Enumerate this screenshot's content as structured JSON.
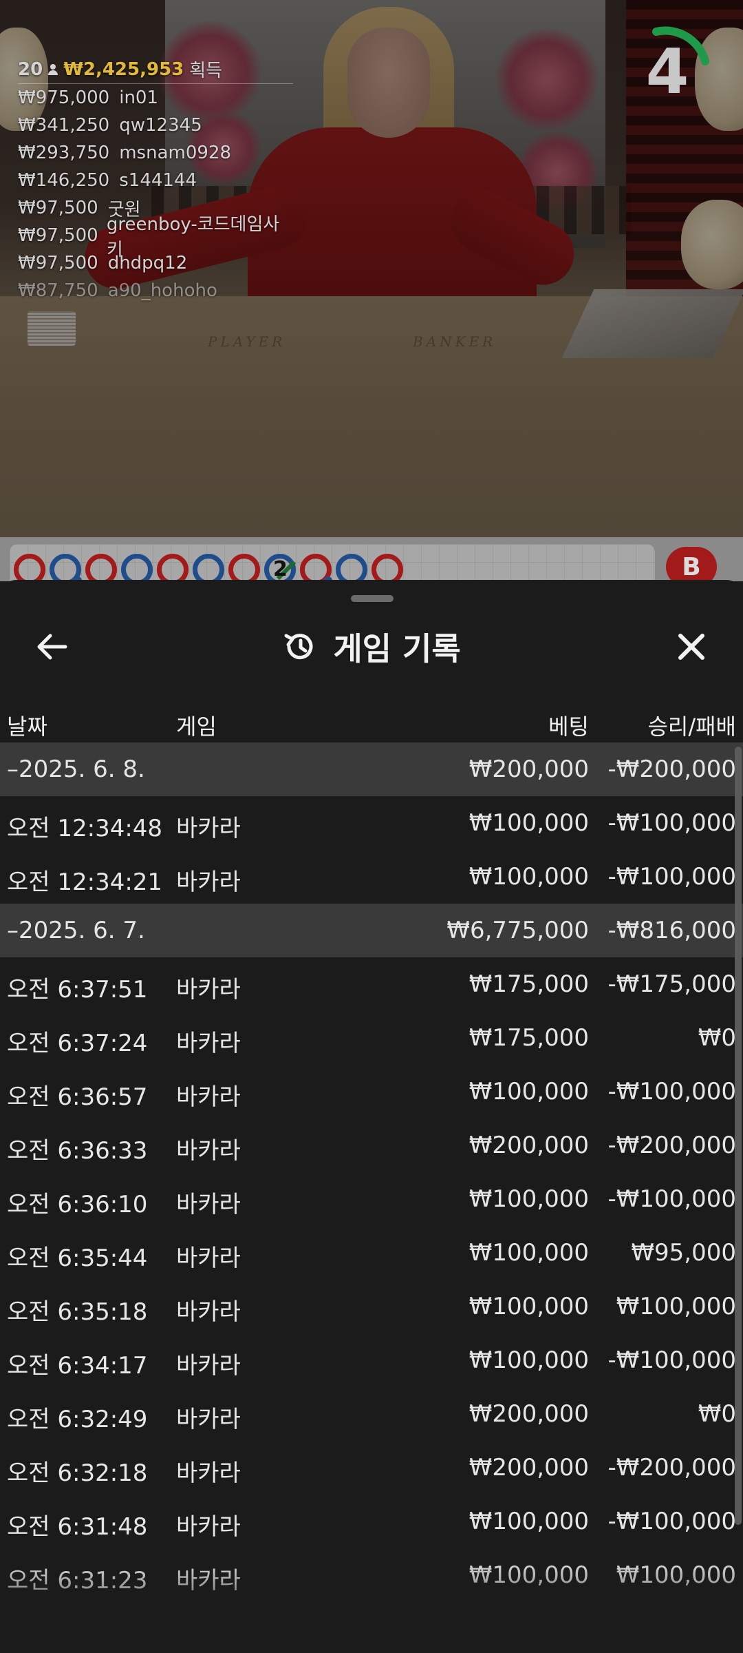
{
  "live_game": {
    "winners": {
      "count": "20",
      "total": "₩2,425,953",
      "suffix": "획득",
      "entries": [
        {
          "amount": "₩975,000",
          "user": "in01"
        },
        {
          "amount": "₩341,250",
          "user": "qw12345"
        },
        {
          "amount": "₩293,750",
          "user": "msnam0928"
        },
        {
          "amount": "₩146,250",
          "user": "s144144"
        },
        {
          "amount": "₩97,500",
          "user": "굿원"
        },
        {
          "amount": "₩97,500",
          "user": "greenboy-코드데임사키"
        },
        {
          "amount": "₩97,500",
          "user": "dhdpq12"
        },
        {
          "amount": "₩87,750",
          "user": "a90_hohoho"
        }
      ]
    },
    "countdown": "4",
    "table_labels": {
      "player": "PLAYER",
      "banker": "BANKER"
    },
    "roadmap": {
      "beads": [
        "B",
        "P",
        "B",
        "P",
        "B",
        "P",
        "B",
        "P",
        "B",
        "P",
        "B"
      ],
      "marked_bead_label": "2",
      "badge": "B"
    }
  },
  "sheet": {
    "title": "게임 기록",
    "columns": {
      "date": "날짜",
      "game": "게임",
      "bet": "베팅",
      "result": "승리/패배"
    },
    "rows": [
      {
        "type": "group",
        "date": "–2025. 6. 8.",
        "game": "",
        "bet": "₩200,000",
        "result": "-₩200,000"
      },
      {
        "type": "item",
        "date": "오전 12:34:48",
        "game": "바카라",
        "bet": "₩100,000",
        "result": "-₩100,000"
      },
      {
        "type": "item",
        "date": "오전 12:34:21",
        "game": "바카라",
        "bet": "₩100,000",
        "result": "-₩100,000"
      },
      {
        "type": "group",
        "date": "–2025. 6. 7.",
        "game": "",
        "bet": "₩6,775,000",
        "result": "-₩816,000"
      },
      {
        "type": "item",
        "date": "오전 6:37:51",
        "game": "바카라",
        "bet": "₩175,000",
        "result": "-₩175,000"
      },
      {
        "type": "item",
        "date": "오전 6:37:24",
        "game": "바카라",
        "bet": "₩175,000",
        "result": "₩0"
      },
      {
        "type": "item",
        "date": "오전 6:36:57",
        "game": "바카라",
        "bet": "₩100,000",
        "result": "-₩100,000"
      },
      {
        "type": "item",
        "date": "오전 6:36:33",
        "game": "바카라",
        "bet": "₩200,000",
        "result": "-₩200,000"
      },
      {
        "type": "item",
        "date": "오전 6:36:10",
        "game": "바카라",
        "bet": "₩100,000",
        "result": "-₩100,000"
      },
      {
        "type": "item",
        "date": "오전 6:35:44",
        "game": "바카라",
        "bet": "₩100,000",
        "result": "₩95,000"
      },
      {
        "type": "item",
        "date": "오전 6:35:18",
        "game": "바카라",
        "bet": "₩100,000",
        "result": "₩100,000"
      },
      {
        "type": "item",
        "date": "오전 6:34:17",
        "game": "바카라",
        "bet": "₩100,000",
        "result": "-₩100,000"
      },
      {
        "type": "item",
        "date": "오전 6:32:49",
        "game": "바카라",
        "bet": "₩200,000",
        "result": "₩0"
      },
      {
        "type": "item",
        "date": "오전 6:32:18",
        "game": "바카라",
        "bet": "₩200,000",
        "result": "-₩200,000"
      },
      {
        "type": "item",
        "date": "오전 6:31:48",
        "game": "바카라",
        "bet": "₩100,000",
        "result": "-₩100,000"
      },
      {
        "type": "item",
        "date": "오전 6:31:23",
        "game": "바카라",
        "bet": "₩100,000",
        "result": "₩100,000"
      }
    ]
  },
  "icons": {
    "back": "arrow-left-icon",
    "history": "history-clock-icon",
    "close": "close-icon",
    "user": "user-icon"
  },
  "colors": {
    "banker": "#a21a1a",
    "player": "#1f4d8c",
    "gold": "#e2b93b",
    "timer_ring": "#1f9a4a",
    "sheet_bg": "#1b1b1b",
    "group_row_bg": "#3a3a3a"
  }
}
